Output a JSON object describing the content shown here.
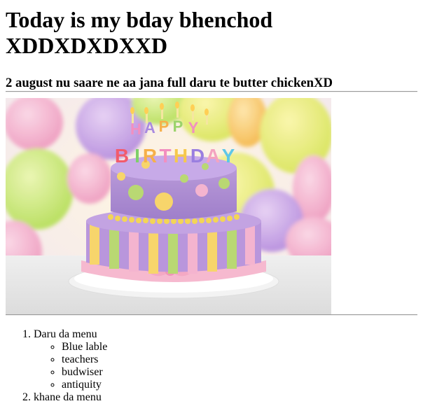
{
  "header": {
    "title": "Today is my bday bhenchod XDDXDXDXXD",
    "subtitle": "2 august nu saare ne aa jana full daru te butter chickenXD"
  },
  "image": {
    "icon": "birthday-cake-photo",
    "cake_text": "HAPPY BIRTHDAY"
  },
  "menu": {
    "items": [
      {
        "label": "Daru da menu",
        "subitems": [
          "Blue lable",
          "teachers",
          "budwiser",
          "antiquity"
        ]
      },
      {
        "label": "khane da menu"
      }
    ]
  }
}
